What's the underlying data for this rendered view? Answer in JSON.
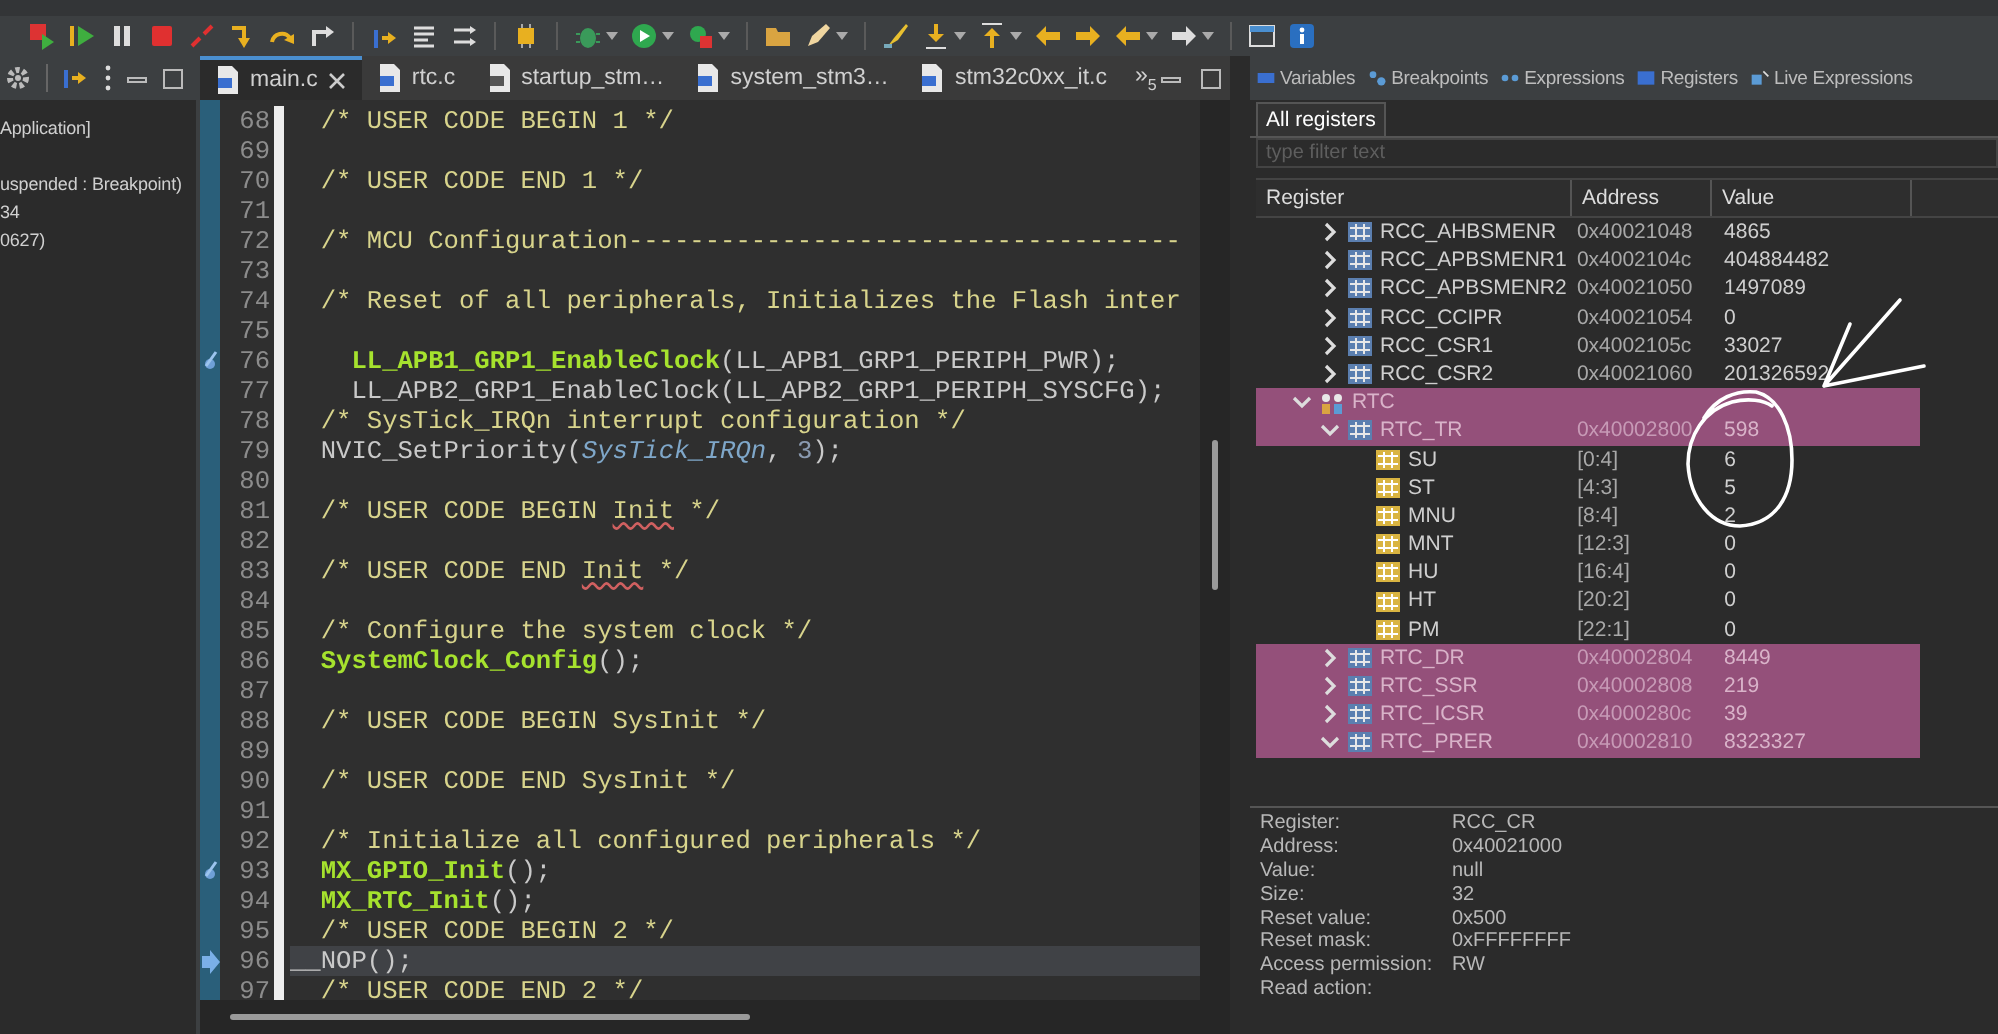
{
  "editor_tabs": [
    {
      "label": "main.c",
      "selected": true,
      "kind": "c"
    },
    {
      "label": "rtc.c",
      "selected": false,
      "kind": "c"
    },
    {
      "label": "startup_stm…",
      "selected": false,
      "kind": "s"
    },
    {
      "label": "system_stm3…",
      "selected": false,
      "kind": "c"
    },
    {
      "label": "stm32c0xx_it.c",
      "selected": false,
      "kind": "c"
    }
  ],
  "editor_overflow": {
    "glyph": "»",
    "count": "5"
  },
  "debug_panel": {
    "lines": [
      "Application]",
      "uspended : Breakpoint)",
      "34",
      "0627)"
    ]
  },
  "code_lines": [
    {
      "number": "68",
      "kind": "plain",
      "current": false,
      "segments": [
        {
          "kind": "comment",
          "text": "  /* USER CODE BEGIN 1 */"
        }
      ]
    },
    {
      "number": "69",
      "kind": "plain",
      "current": false
    },
    {
      "number": "70",
      "kind": "plain",
      "current": false,
      "segments": [
        {
          "kind": "comment",
          "text": "  /* USER CODE END 1 */"
        }
      ]
    },
    {
      "number": "71",
      "kind": "plain",
      "current": false
    },
    {
      "number": "72",
      "kind": "plain",
      "current": false,
      "segments": [
        {
          "kind": "comment",
          "text": "  /* MCU Configuration------------------------------------"
        }
      ]
    },
    {
      "number": "73",
      "kind": "plain",
      "current": false
    },
    {
      "number": "74",
      "kind": "plain",
      "current": false,
      "segments": [
        {
          "kind": "comment",
          "text": "  /* Reset of all peripherals, Initializes the Flash inter"
        }
      ]
    },
    {
      "number": "75",
      "kind": "plain",
      "current": false
    },
    {
      "number": "76",
      "kind": "breakpoint",
      "current": false,
      "segments": [
        {
          "kind": "function",
          "text": "    LL_APB1_GRP1_EnableClock"
        },
        {
          "kind": "plain",
          "text": "(LL_APB1_GRP1_PERIPH_PWR);"
        }
      ]
    },
    {
      "number": "77",
      "kind": "plain",
      "current": false,
      "segments": [
        {
          "kind": "plain",
          "text": "    LL_APB2_GRP1_EnableClock(LL_APB2_GRP1_PERIPH_SYSCFG);"
        }
      ]
    },
    {
      "number": "78",
      "kind": "plain",
      "current": false,
      "segments": [
        {
          "kind": "comment",
          "text": "  /* SysTick_IRQn interrupt configuration */"
        }
      ]
    },
    {
      "number": "79",
      "kind": "plain",
      "current": false,
      "segments": [
        {
          "kind": "plain",
          "text": "  NVIC_SetPriority("
        },
        {
          "kind": "param",
          "text": "SysTick_IRQn"
        },
        {
          "kind": "plain",
          "text": ","
        },
        {
          "kind": "number",
          "text": " 3"
        },
        {
          "kind": "plain",
          "text": ");"
        }
      ]
    },
    {
      "number": "80",
      "kind": "plain",
      "current": false
    },
    {
      "number": "81",
      "kind": "plain",
      "current": false,
      "segments": [
        {
          "kind": "comment",
          "text": "  /* USER CODE BEGIN "
        },
        {
          "kind": "spell",
          "text": "Init"
        },
        {
          "kind": "comment",
          "text": " */"
        }
      ]
    },
    {
      "number": "82",
      "kind": "plain",
      "current": false
    },
    {
      "number": "83",
      "kind": "plain",
      "current": false,
      "segments": [
        {
          "kind": "comment",
          "text": "  /* USER CODE END "
        },
        {
          "kind": "spell",
          "text": "Init"
        },
        {
          "kind": "comment",
          "text": " */"
        }
      ]
    },
    {
      "number": "84",
      "kind": "plain",
      "current": false
    },
    {
      "number": "85",
      "kind": "plain",
      "current": false,
      "segments": [
        {
          "kind": "comment",
          "text": "  /* Configure the system clock */"
        }
      ]
    },
    {
      "number": "86",
      "kind": "plain",
      "current": false,
      "segments": [
        {
          "kind": "function",
          "text": "  SystemClock_Config"
        },
        {
          "kind": "plain",
          "text": "();"
        }
      ]
    },
    {
      "number": "87",
      "kind": "plain",
      "current": false
    },
    {
      "number": "88",
      "kind": "plain",
      "current": false,
      "segments": [
        {
          "kind": "comment",
          "text": "  /* USER CODE BEGIN SysInit */"
        }
      ]
    },
    {
      "number": "89",
      "kind": "plain",
      "current": false
    },
    {
      "number": "90",
      "kind": "plain",
      "current": false,
      "segments": [
        {
          "kind": "comment",
          "text": "  /* USER CODE END SysInit */"
        }
      ]
    },
    {
      "number": "91",
      "kind": "plain",
      "current": false
    },
    {
      "number": "92",
      "kind": "plain",
      "current": false,
      "segments": [
        {
          "kind": "comment",
          "text": "  /* Initialize all configured peripherals */"
        }
      ]
    },
    {
      "number": "93",
      "kind": "breakpoint",
      "current": false,
      "segments": [
        {
          "kind": "function",
          "text": "  MX_GPIO_Init"
        },
        {
          "kind": "plain",
          "text": "();"
        }
      ]
    },
    {
      "number": "94",
      "kind": "plain",
      "current": false,
      "segments": [
        {
          "kind": "function",
          "text": "  MX_RTC_Init"
        },
        {
          "kind": "plain",
          "text": "();"
        }
      ]
    },
    {
      "number": "95",
      "kind": "plain",
      "current": false,
      "segments": [
        {
          "kind": "comment",
          "text": "  /* USER CODE BEGIN 2 */"
        }
      ]
    },
    {
      "number": "96",
      "kind": "instruction-pointer",
      "current": true,
      "segments": [
        {
          "kind": "plain",
          "text": "__NOP();"
        }
      ]
    },
    {
      "number": "97",
      "kind": "plain",
      "current": false,
      "segments": [
        {
          "kind": "comment",
          "text": "  /* USER CODE END 2 */"
        }
      ]
    }
  ],
  "registers_view": {
    "view_tabs": [
      {
        "label": "Variables",
        "selected": false,
        "kind": "variables"
      },
      {
        "label": "Breakpoints",
        "selected": false,
        "kind": "breakpoints"
      },
      {
        "label": "Expressions",
        "selected": false,
        "kind": "expressions"
      },
      {
        "label": "Registers",
        "selected": false,
        "kind": "registers"
      },
      {
        "label": "Live Expressions",
        "selected": false,
        "kind": "live"
      }
    ],
    "subtab": {
      "label": "All registers",
      "selected": true
    },
    "filter": {
      "placeholder": "type filter text"
    },
    "columns": [
      "Register",
      "Address",
      "Value"
    ],
    "rows": [
      {
        "kind": "continuation",
        "children": [
          {
            "kind": "register",
            "name": "RCC_AHBSMENR",
            "address": "0x40021048",
            "value": "4865",
            "expanded": false,
            "selected": false
          },
          {
            "kind": "register",
            "name": "RCC_APBSMENR1",
            "address": "0x4002104c",
            "value": "404884482",
            "expanded": false,
            "selected": false
          },
          {
            "kind": "register",
            "name": "RCC_APBSMENR2",
            "address": "0x40021050",
            "value": "1497089",
            "expanded": false,
            "selected": false
          },
          {
            "kind": "register",
            "name": "RCC_CCIPR",
            "address": "0x40021054",
            "value": "0",
            "expanded": false,
            "selected": false
          },
          {
            "kind": "register",
            "name": "RCC_CSR1",
            "address": "0x4002105c",
            "value": "33027",
            "expanded": false,
            "selected": false
          },
          {
            "kind": "register",
            "name": "RCC_CSR2",
            "address": "0x40021060",
            "value": "201326592",
            "expanded": false,
            "selected": false
          }
        ]
      },
      {
        "kind": "peripheral",
        "name": "RTC",
        "expanded": true,
        "selected": true,
        "children": [
          {
            "kind": "register",
            "name": "RTC_TR",
            "address": "0x40002800",
            "value": "598",
            "expanded": true,
            "selected": true,
            "children": [
              {
                "kind": "field",
                "name": "SU",
                "address": "[0:4]",
                "value": "6",
                "selected": false
              },
              {
                "kind": "field",
                "name": "ST",
                "address": "[4:3]",
                "value": "5",
                "selected": false
              },
              {
                "kind": "field",
                "name": "MNU",
                "address": "[8:4]",
                "value": "2",
                "selected": false
              },
              {
                "kind": "field",
                "name": "MNT",
                "address": "[12:3]",
                "value": "0",
                "selected": false
              },
              {
                "kind": "field",
                "name": "HU",
                "address": "[16:4]",
                "value": "0",
                "selected": false
              },
              {
                "kind": "field",
                "name": "HT",
                "address": "[20:2]",
                "value": "0",
                "selected": false
              },
              {
                "kind": "field",
                "name": "PM",
                "address": "[22:1]",
                "value": "0",
                "selected": false
              }
            ]
          },
          {
            "kind": "register",
            "name": "RTC_DR",
            "address": "0x40002804",
            "value": "8449",
            "expanded": false,
            "selected": true
          },
          {
            "kind": "register",
            "name": "RTC_SSR",
            "address": "0x40002808",
            "value": "219",
            "expanded": false,
            "selected": true
          },
          {
            "kind": "register",
            "name": "RTC_ICSR",
            "address": "0x4000280c",
            "value": "39",
            "expanded": false,
            "selected": true
          },
          {
            "kind": "register",
            "name": "RTC_PRER",
            "address": "0x40002810",
            "value": "8323327",
            "expanded": true,
            "selected": true
          }
        ]
      }
    ],
    "details": [
      {
        "label": "Register:",
        "value": "RCC_CR"
      },
      {
        "label": "Address:",
        "value": "0x40021000"
      },
      {
        "label": "Value:",
        "value": "null"
      },
      {
        "label": "Size:",
        "value": "32"
      },
      {
        "label": "Reset value:",
        "value": "0x500"
      },
      {
        "label": "Reset mask:",
        "value": "0xFFFFFFFF"
      },
      {
        "label": "Access permission:",
        "value": "RW"
      },
      {
        "label": "Read action:"
      }
    ]
  }
}
